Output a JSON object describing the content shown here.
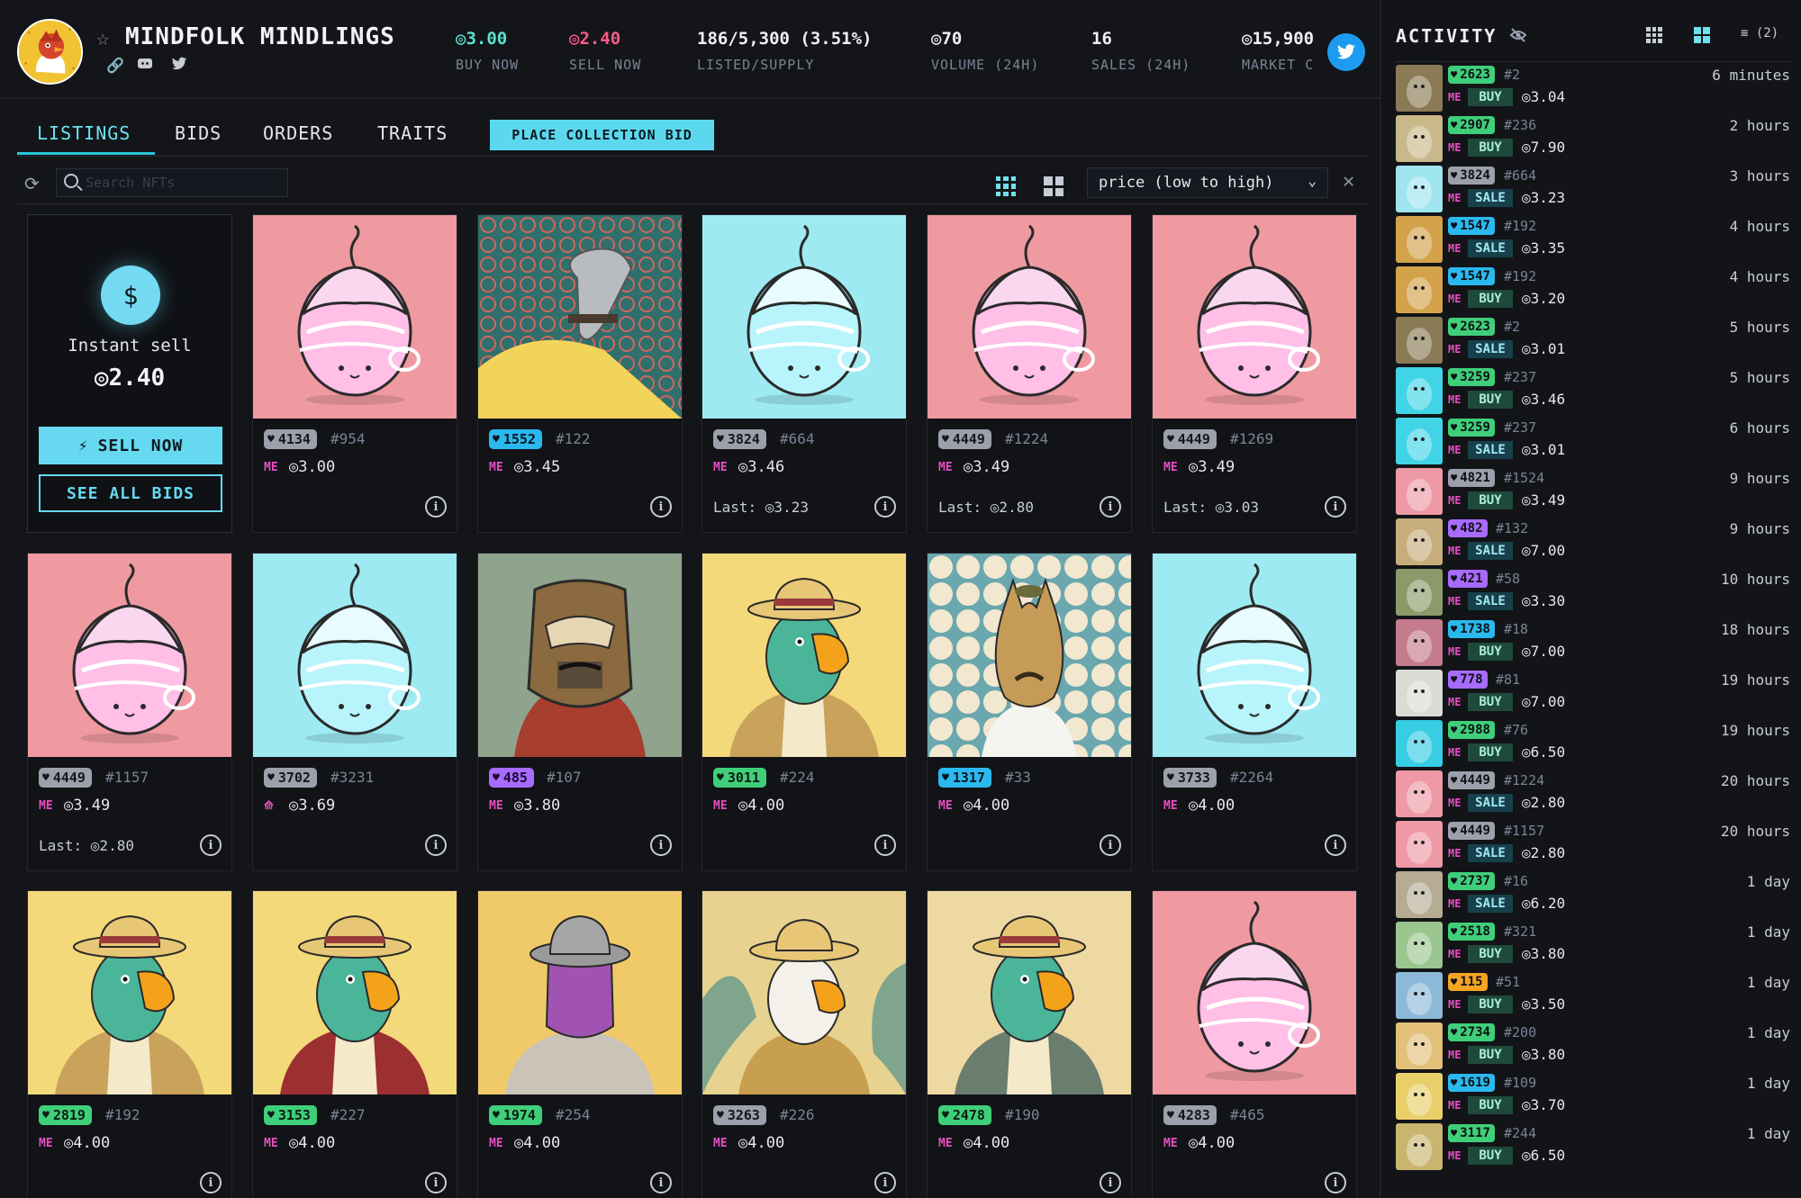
{
  "header": {
    "collection_name": "MINDFOLK MINDLINGS",
    "stats": [
      {
        "value": "◎3.00",
        "label": "BUY NOW",
        "color": "teal"
      },
      {
        "value": "◎2.40",
        "label": "SELL NOW",
        "color": "pink"
      },
      {
        "value": "186/5,300 (3.51%)",
        "label": "LISTED/SUPPLY",
        "color": ""
      },
      {
        "value": "◎70",
        "label": "VOLUME (24H)",
        "color": ""
      },
      {
        "value": "16",
        "label": "SALES (24H)",
        "color": ""
      },
      {
        "value": "◎15,900",
        "label": "MARKET C",
        "color": ""
      }
    ]
  },
  "tabs": {
    "listings": "LISTINGS",
    "bids": "BIDS",
    "orders": "ORDERS",
    "traits": "TRAITS",
    "place_bid": "PLACE COLLECTION BID"
  },
  "toolbar": {
    "search_placeholder": "Search NFTs",
    "sort_label": "price (low to high)"
  },
  "instant_sell": {
    "coin_symbol": "$",
    "title": "Instant sell",
    "price": "◎2.40",
    "sell_now": "SELL NOW",
    "see_all_bids": "SEE ALL BIDS"
  },
  "listings": [
    {
      "rank": "4134",
      "rank_color": "gray",
      "id": "#954",
      "price": "◎3.00",
      "last": "",
      "art": "mindling-pink"
    },
    {
      "rank": "1552",
      "rank_color": "blue",
      "id": "#122",
      "price": "◎3.45",
      "last": "",
      "art": "hound-teal"
    },
    {
      "rank": "3824",
      "rank_color": "gray",
      "id": "#664",
      "price": "◎3.46",
      "last": "Last: ◎3.23",
      "art": "mindling-cyan"
    },
    {
      "rank": "4449",
      "rank_color": "gray",
      "id": "#1224",
      "price": "◎3.49",
      "last": "Last: ◎2.80",
      "art": "mindling-pink"
    },
    {
      "rank": "4449",
      "rank_color": "gray",
      "id": "#1269",
      "price": "◎3.49",
      "last": "Last: ◎3.03",
      "art": "mindling-pink"
    },
    {
      "rank": "4449",
      "rank_color": "gray",
      "id": "#1157",
      "price": "◎3.49",
      "last": "Last: ◎2.80",
      "art": "mindling-pink"
    },
    {
      "rank": "3702",
      "rank_color": "gray",
      "id": "#3231",
      "price": "◎3.69",
      "last": "",
      "art": "mindling-cyan",
      "marketplace": "other"
    },
    {
      "rank": "485",
      "rank_color": "purple",
      "id": "#107",
      "price": "◎3.80",
      "last": "",
      "art": "owl-mask"
    },
    {
      "rank": "3011",
      "rank_color": "green",
      "id": "#224",
      "price": "◎4.00",
      "last": "",
      "art": "parrot-yellow"
    },
    {
      "rank": "1317",
      "rank_color": "blue",
      "id": "#33",
      "price": "◎4.00",
      "last": "",
      "art": "llama"
    },
    {
      "rank": "3733",
      "rank_color": "gray",
      "id": "#2264",
      "price": "◎4.00",
      "last": "",
      "art": "mindling-cyan"
    },
    {
      "rank": "2819",
      "rank_color": "green",
      "id": "#192",
      "price": "◎4.00",
      "last": "",
      "art": "parrot-yellow"
    },
    {
      "rank": "3153",
      "rank_color": "green",
      "id": "#227",
      "price": "◎4.00",
      "last": "",
      "art": "parrot-red"
    },
    {
      "rank": "1974",
      "rank_color": "green",
      "id": "#254",
      "price": "◎4.00",
      "last": "",
      "art": "purple-face"
    },
    {
      "rank": "3263",
      "rank_color": "gray",
      "id": "#226",
      "price": "◎4.00",
      "last": "",
      "art": "eagle-leaves"
    },
    {
      "rank": "2478",
      "rank_color": "green",
      "id": "#190",
      "price": "◎4.00",
      "last": "",
      "art": "parrot-beige"
    },
    {
      "rank": "4283",
      "rank_color": "gray",
      "id": "#465",
      "price": "◎4.00",
      "last": "",
      "art": "mindling-pink"
    }
  ],
  "activity": {
    "title": "ACTIVITY",
    "filter_label": "(2)",
    "items": [
      {
        "rank": "2623",
        "rank_color": "green",
        "id": "#2",
        "type": "BUY",
        "price": "◎3.04",
        "time": "6 minutes",
        "thumb": "#8a7a55"
      },
      {
        "rank": "2907",
        "rank_color": "green",
        "id": "#236",
        "type": "BUY",
        "price": "◎7.90",
        "time": "2 hours",
        "thumb": "#c9b98a"
      },
      {
        "rank": "3824",
        "rank_color": "gray",
        "id": "#664",
        "type": "SALE",
        "price": "◎3.23",
        "time": "3 hours",
        "thumb": "#9fe5ee"
      },
      {
        "rank": "1547",
        "rank_color": "blue",
        "id": "#192",
        "type": "SALE",
        "price": "◎3.35",
        "time": "4 hours",
        "thumb": "#d4a24a"
      },
      {
        "rank": "1547",
        "rank_color": "blue",
        "id": "#192",
        "type": "BUY",
        "price": "◎3.20",
        "time": "4 hours",
        "thumb": "#d4a24a"
      },
      {
        "rank": "2623",
        "rank_color": "green",
        "id": "#2",
        "type": "SALE",
        "price": "◎3.01",
        "time": "5 hours",
        "thumb": "#8a7a55"
      },
      {
        "rank": "3259",
        "rank_color": "green",
        "id": "#237",
        "type": "BUY",
        "price": "◎3.46",
        "time": "5 hours",
        "thumb": "#41d4e6"
      },
      {
        "rank": "3259",
        "rank_color": "green",
        "id": "#237",
        "type": "SALE",
        "price": "◎3.01",
        "time": "6 hours",
        "thumb": "#41d4e6"
      },
      {
        "rank": "4821",
        "rank_color": "gray",
        "id": "#1524",
        "type": "BUY",
        "price": "◎3.49",
        "time": "9 hours",
        "thumb": "#ee9aa6"
      },
      {
        "rank": "482",
        "rank_color": "purple",
        "id": "#132",
        "type": "SALE",
        "price": "◎7.00",
        "time": "9 hours",
        "thumb": "#c7ad7c"
      },
      {
        "rank": "421",
        "rank_color": "purple",
        "id": "#58",
        "type": "SALE",
        "price": "◎3.30",
        "time": "10 hours",
        "thumb": "#8c9a6a"
      },
      {
        "rank": "1738",
        "rank_color": "blue",
        "id": "#18",
        "type": "BUY",
        "price": "◎7.00",
        "time": "18 hours",
        "thumb": "#c47b8e"
      },
      {
        "rank": "778",
        "rank_color": "purple",
        "id": "#81",
        "type": "BUY",
        "price": "◎7.00",
        "time": "19 hours",
        "thumb": "#d9dcd4"
      },
      {
        "rank": "2988",
        "rank_color": "green",
        "id": "#76",
        "type": "BUY",
        "price": "◎6.50",
        "time": "19 hours",
        "thumb": "#37cde2"
      },
      {
        "rank": "4449",
        "rank_color": "gray",
        "id": "#1224",
        "type": "SALE",
        "price": "◎2.80",
        "time": "20 hours",
        "thumb": "#ee9aa6"
      },
      {
        "rank": "4449",
        "rank_color": "gray",
        "id": "#1157",
        "type": "SALE",
        "price": "◎2.80",
        "time": "20 hours",
        "thumb": "#ee9aa6"
      },
      {
        "rank": "2737",
        "rank_color": "green",
        "id": "#16",
        "type": "SALE",
        "price": "◎6.20",
        "time": "1 day",
        "thumb": "#b6ac94"
      },
      {
        "rank": "2518",
        "rank_color": "green",
        "id": "#321",
        "type": "BUY",
        "price": "◎3.80",
        "time": "1 day",
        "thumb": "#9ac58f"
      },
      {
        "rank": "115",
        "rank_color": "orange",
        "id": "#51",
        "type": "BUY",
        "price": "◎3.50",
        "time": "1 day",
        "thumb": "#8db9d9"
      },
      {
        "rank": "2734",
        "rank_color": "green",
        "id": "#200",
        "type": "BUY",
        "price": "◎3.80",
        "time": "1 day",
        "thumb": "#e2c07a"
      },
      {
        "rank": "1619",
        "rank_color": "blue",
        "id": "#109",
        "type": "BUY",
        "price": "◎3.70",
        "time": "1 day",
        "thumb": "#e9cf6a"
      },
      {
        "rank": "3117",
        "rank_color": "green",
        "id": "#244",
        "type": "BUY",
        "price": "◎6.50",
        "time": "1 day",
        "thumb": "#c9b56f"
      }
    ]
  },
  "colors": {
    "accent": "#5bd8ee",
    "sell_pink": "#ff5a8a",
    "buy_teal": "#5ce0d0",
    "background": "#131519"
  }
}
